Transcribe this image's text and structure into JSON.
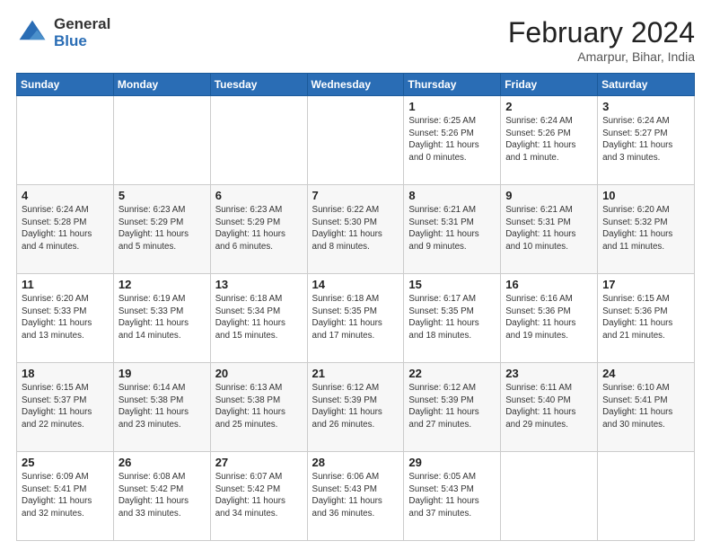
{
  "header": {
    "logo_general": "General",
    "logo_blue": "Blue",
    "month_title": "February 2024",
    "subtitle": "Amarpur, Bihar, India"
  },
  "days_of_week": [
    "Sunday",
    "Monday",
    "Tuesday",
    "Wednesday",
    "Thursday",
    "Friday",
    "Saturday"
  ],
  "weeks": [
    [
      {
        "num": "",
        "info": ""
      },
      {
        "num": "",
        "info": ""
      },
      {
        "num": "",
        "info": ""
      },
      {
        "num": "",
        "info": ""
      },
      {
        "num": "1",
        "info": "Sunrise: 6:25 AM\nSunset: 5:26 PM\nDaylight: 11 hours and 0 minutes."
      },
      {
        "num": "2",
        "info": "Sunrise: 6:24 AM\nSunset: 5:26 PM\nDaylight: 11 hours and 1 minute."
      },
      {
        "num": "3",
        "info": "Sunrise: 6:24 AM\nSunset: 5:27 PM\nDaylight: 11 hours and 3 minutes."
      }
    ],
    [
      {
        "num": "4",
        "info": "Sunrise: 6:24 AM\nSunset: 5:28 PM\nDaylight: 11 hours and 4 minutes."
      },
      {
        "num": "5",
        "info": "Sunrise: 6:23 AM\nSunset: 5:29 PM\nDaylight: 11 hours and 5 minutes."
      },
      {
        "num": "6",
        "info": "Sunrise: 6:23 AM\nSunset: 5:29 PM\nDaylight: 11 hours and 6 minutes."
      },
      {
        "num": "7",
        "info": "Sunrise: 6:22 AM\nSunset: 5:30 PM\nDaylight: 11 hours and 8 minutes."
      },
      {
        "num": "8",
        "info": "Sunrise: 6:21 AM\nSunset: 5:31 PM\nDaylight: 11 hours and 9 minutes."
      },
      {
        "num": "9",
        "info": "Sunrise: 6:21 AM\nSunset: 5:31 PM\nDaylight: 11 hours and 10 minutes."
      },
      {
        "num": "10",
        "info": "Sunrise: 6:20 AM\nSunset: 5:32 PM\nDaylight: 11 hours and 11 minutes."
      }
    ],
    [
      {
        "num": "11",
        "info": "Sunrise: 6:20 AM\nSunset: 5:33 PM\nDaylight: 11 hours and 13 minutes."
      },
      {
        "num": "12",
        "info": "Sunrise: 6:19 AM\nSunset: 5:33 PM\nDaylight: 11 hours and 14 minutes."
      },
      {
        "num": "13",
        "info": "Sunrise: 6:18 AM\nSunset: 5:34 PM\nDaylight: 11 hours and 15 minutes."
      },
      {
        "num": "14",
        "info": "Sunrise: 6:18 AM\nSunset: 5:35 PM\nDaylight: 11 hours and 17 minutes."
      },
      {
        "num": "15",
        "info": "Sunrise: 6:17 AM\nSunset: 5:35 PM\nDaylight: 11 hours and 18 minutes."
      },
      {
        "num": "16",
        "info": "Sunrise: 6:16 AM\nSunset: 5:36 PM\nDaylight: 11 hours and 19 minutes."
      },
      {
        "num": "17",
        "info": "Sunrise: 6:15 AM\nSunset: 5:36 PM\nDaylight: 11 hours and 21 minutes."
      }
    ],
    [
      {
        "num": "18",
        "info": "Sunrise: 6:15 AM\nSunset: 5:37 PM\nDaylight: 11 hours and 22 minutes."
      },
      {
        "num": "19",
        "info": "Sunrise: 6:14 AM\nSunset: 5:38 PM\nDaylight: 11 hours and 23 minutes."
      },
      {
        "num": "20",
        "info": "Sunrise: 6:13 AM\nSunset: 5:38 PM\nDaylight: 11 hours and 25 minutes."
      },
      {
        "num": "21",
        "info": "Sunrise: 6:12 AM\nSunset: 5:39 PM\nDaylight: 11 hours and 26 minutes."
      },
      {
        "num": "22",
        "info": "Sunrise: 6:12 AM\nSunset: 5:39 PM\nDaylight: 11 hours and 27 minutes."
      },
      {
        "num": "23",
        "info": "Sunrise: 6:11 AM\nSunset: 5:40 PM\nDaylight: 11 hours and 29 minutes."
      },
      {
        "num": "24",
        "info": "Sunrise: 6:10 AM\nSunset: 5:41 PM\nDaylight: 11 hours and 30 minutes."
      }
    ],
    [
      {
        "num": "25",
        "info": "Sunrise: 6:09 AM\nSunset: 5:41 PM\nDaylight: 11 hours and 32 minutes."
      },
      {
        "num": "26",
        "info": "Sunrise: 6:08 AM\nSunset: 5:42 PM\nDaylight: 11 hours and 33 minutes."
      },
      {
        "num": "27",
        "info": "Sunrise: 6:07 AM\nSunset: 5:42 PM\nDaylight: 11 hours and 34 minutes."
      },
      {
        "num": "28",
        "info": "Sunrise: 6:06 AM\nSunset: 5:43 PM\nDaylight: 11 hours and 36 minutes."
      },
      {
        "num": "29",
        "info": "Sunrise: 6:05 AM\nSunset: 5:43 PM\nDaylight: 11 hours and 37 minutes."
      },
      {
        "num": "",
        "info": ""
      },
      {
        "num": "",
        "info": ""
      }
    ]
  ]
}
